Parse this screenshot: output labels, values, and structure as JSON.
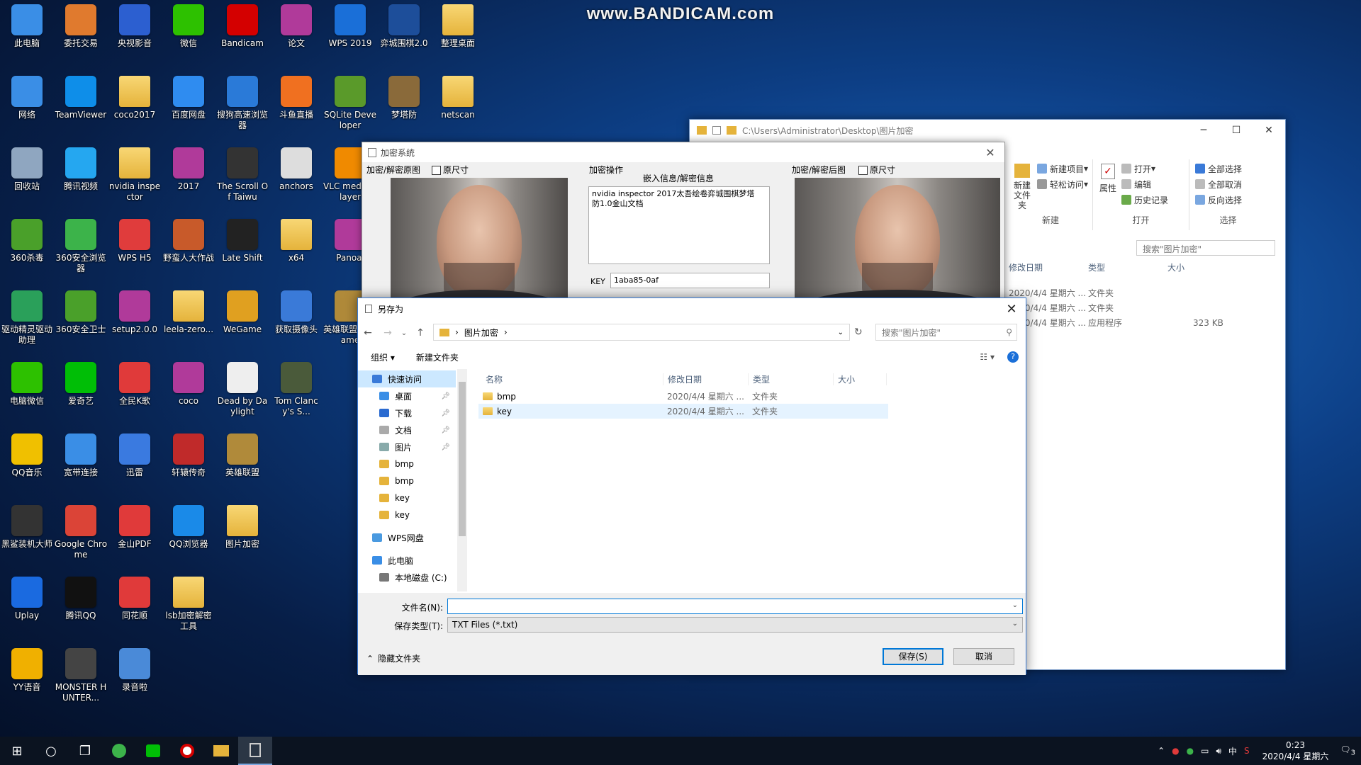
{
  "watermark": "www.BANDICAM.com",
  "desktop_icons": [
    {
      "label": "此电脑",
      "icon": "computer-icon",
      "color": "#3a8ee6"
    },
    {
      "label": "委托交易",
      "icon": "house-icon",
      "color": "#e07a2e"
    },
    {
      "label": "央视影音",
      "icon": "play-icon",
      "color": "#2c5fd0"
    },
    {
      "label": "微信",
      "icon": "wechat-icon",
      "color": "#2dc100"
    },
    {
      "label": "Bandicam",
      "icon": "record-icon",
      "color": "#d40000"
    },
    {
      "label": "论文",
      "icon": "archive-icon",
      "color": "#b03a9a"
    },
    {
      "label": "WPS 2019",
      "icon": "wps-icon",
      "color": "#1a6fd8"
    },
    {
      "label": "弈城围棋2.0",
      "icon": "go-icon",
      "color": "#1d4e9a"
    },
    {
      "label": "整理桌面",
      "icon": "folder-icon",
      "color": "#e5b33b"
    },
    {
      "label": "网络",
      "icon": "network-icon",
      "color": "#3a8ee6"
    },
    {
      "label": "TeamViewer",
      "icon": "teamviewer-icon",
      "color": "#0e8ee9"
    },
    {
      "label": "coco2017",
      "icon": "folder-icon",
      "color": "#e5b33b"
    },
    {
      "label": "百度网盘",
      "icon": "cloud-icon",
      "color": "#2f8cf0"
    },
    {
      "label": "搜狗高速浏览器",
      "icon": "sogou-icon",
      "color": "#2a7ad8"
    },
    {
      "label": "斗鱼直播",
      "icon": "douyu-icon",
      "color": "#f07020"
    },
    {
      "label": "SQLite Developer",
      "icon": "sqlite-icon",
      "color": "#5a9a2a"
    },
    {
      "label": "梦塔防",
      "icon": "game-icon",
      "color": "#8a6a3a"
    },
    {
      "label": "netscan",
      "icon": "folder-icon",
      "color": "#e5b33b"
    },
    {
      "label": "回收站",
      "icon": "recycle-bin-icon",
      "color": "#8fa6c0"
    },
    {
      "label": "腾讯视频",
      "icon": "video-icon",
      "color": "#25a7f0"
    },
    {
      "label": "nvidia inspector",
      "icon": "folder-icon",
      "color": "#e5b33b"
    },
    {
      "label": "2017",
      "icon": "archive-icon",
      "color": "#b03a9a"
    },
    {
      "label": "The Scroll Of Taiwu",
      "icon": "taiwu-icon",
      "color": "#333333"
    },
    {
      "label": "anchors",
      "icon": "document-icon",
      "color": "#dddddd"
    },
    {
      "label": "VLC media player",
      "icon": "vlc-icon",
      "color": "#f08a00"
    },
    {
      "label": "360杀毒",
      "icon": "shield-icon",
      "color": "#4aa02a"
    },
    {
      "label": "360安全浏览器",
      "icon": "browser-icon",
      "color": "#3cb34a"
    },
    {
      "label": "WPS H5",
      "icon": "wps-h5-icon",
      "color": "#e03c3c"
    },
    {
      "label": "野蛮人大作战",
      "icon": "game-icon",
      "color": "#c85a2a"
    },
    {
      "label": "Late Shift",
      "icon": "film-icon",
      "color": "#222222"
    },
    {
      "label": "x64",
      "icon": "folder-icon",
      "color": "#e5b33b"
    },
    {
      "label": "Panoal",
      "icon": "archive-icon",
      "color": "#b03a9a"
    },
    {
      "label": "驱动精灵驱动助理",
      "icon": "driver-icon",
      "color": "#2aa05a"
    },
    {
      "label": "360安全卫士",
      "icon": "guard-icon",
      "color": "#4aa02a"
    },
    {
      "label": "setup2.0.0",
      "icon": "archive-icon",
      "color": "#b03a9a"
    },
    {
      "label": "leela-zero...",
      "icon": "folder-icon",
      "color": "#e5b33b"
    },
    {
      "label": "WeGame",
      "icon": "wegame-icon",
      "color": "#e0a020"
    },
    {
      "label": "获取摄像头",
      "icon": "camera-icon",
      "color": "#3a7ad8"
    },
    {
      "label": "英雄联盟WeGame",
      "icon": "lol-icon",
      "color": "#b08a3a"
    },
    {
      "label": "电脑微信",
      "icon": "wechat-icon",
      "color": "#2dc100"
    },
    {
      "label": "爱奇艺",
      "icon": "iqiyi-icon",
      "color": "#00be06"
    },
    {
      "label": "全民K歌",
      "icon": "karaoke-icon",
      "color": "#e03a3a"
    },
    {
      "label": "coco",
      "icon": "archive-icon",
      "color": "#b03a9a"
    },
    {
      "label": "Dead by Daylight",
      "icon": "document-icon",
      "color": "#eeeeee"
    },
    {
      "label": "Tom Clancy's S...",
      "icon": "game-icon",
      "color": "#4a5a3a"
    },
    {
      "label": "QQ音乐",
      "icon": "music-icon",
      "color": "#f0c000"
    },
    {
      "label": "宽带连接",
      "icon": "network-icon",
      "color": "#3a8ee6"
    },
    {
      "label": "迅雷",
      "icon": "thunder-icon",
      "color": "#3a7ae0"
    },
    {
      "label": "轩辕传奇",
      "icon": "game-icon",
      "color": "#c02a2a"
    },
    {
      "label": "英雄联盟",
      "icon": "lol-icon",
      "color": "#b08a3a"
    },
    {
      "label": "黑鲨装机大师",
      "icon": "shark-icon",
      "color": "#333333"
    },
    {
      "label": "Google Chrome",
      "icon": "chrome-icon",
      "color": "#db4437"
    },
    {
      "label": "金山PDF",
      "icon": "pdf-icon",
      "color": "#e03a3a"
    },
    {
      "label": "QQ浏览器",
      "icon": "qq-browser-icon",
      "color": "#1a8ae8"
    },
    {
      "label": "图片加密",
      "icon": "folder-icon",
      "color": "#e5b33b"
    },
    {
      "label": "Uplay",
      "icon": "uplay-icon",
      "color": "#1a6ae0"
    },
    {
      "label": "腾讯QQ",
      "icon": "qq-icon",
      "color": "#111111"
    },
    {
      "label": "同花顺",
      "icon": "cards-icon",
      "color": "#e03a3a"
    },
    {
      "label": "lsb加密解密工具",
      "icon": "folder-icon",
      "color": "#e5b33b"
    },
    {
      "label": "YY语音",
      "icon": "yy-icon",
      "color": "#f0b000"
    },
    {
      "label": "MONSTER HUNTER...",
      "icon": "game-icon",
      "color": "#444444"
    },
    {
      "label": "录音啦",
      "icon": "recorder-icon",
      "color": "#4a8ad8"
    }
  ],
  "explorer": {
    "path": "C:\\Users\\Administrator\\Desktop\\图片加密",
    "ribbon": {
      "new_item": "新建项目",
      "easy_access": "轻松访问",
      "new_folder": "新建\n文件夹",
      "group_new": "新建",
      "properties": "属性",
      "open": "打开",
      "edit": "编辑",
      "history": "历史记录",
      "group_open": "打开",
      "select_all": "全部选择",
      "select_none": "全部取消",
      "invert": "反向选择",
      "group_select": "选择"
    },
    "search_placeholder": "搜索\"图片加密\"",
    "columns": [
      "修改日期",
      "类型",
      "大小"
    ],
    "rows": [
      {
        "date": "2020/4/4 星期六 ...",
        "type": "文件夹",
        "size": ""
      },
      {
        "date": "2020/4/4 星期六 ...",
        "type": "文件夹",
        "size": ""
      },
      {
        "date": "2020/4/4 星期六 ...",
        "type": "应用程序",
        "size": "323 KB"
      }
    ]
  },
  "enc": {
    "title": "加密系统",
    "left_label": "加密/解密原图",
    "orig_size": "原尺寸",
    "ops_label": "加密操作",
    "embed_label": "嵌入信息/解密信息",
    "info_text": "nvidia inspector 2017太吾绘卷弈城围棋梦塔防1.0金山文档",
    "key_label": "KEY",
    "key_value": "1aba85-0af",
    "right_label": "加密/解密后图",
    "orig_size_right": "原尺寸"
  },
  "save": {
    "title": "另存为",
    "breadcrumb": "图片加密",
    "search_placeholder": "搜索\"图片加密\"",
    "organize": "组织 ▾",
    "new_folder": "新建文件夹",
    "nav": [
      {
        "label": "快速访问",
        "icon": "star-icon",
        "pin": false,
        "sel": true
      },
      {
        "label": "桌面",
        "icon": "desktop-icon",
        "pin": true
      },
      {
        "label": "下载",
        "icon": "download-icon",
        "pin": true
      },
      {
        "label": "文档",
        "icon": "documents-icon",
        "pin": true
      },
      {
        "label": "图片",
        "icon": "pictures-icon",
        "pin": true
      },
      {
        "label": "bmp",
        "icon": "folder-icon",
        "pin": false
      },
      {
        "label": "bmp",
        "icon": "folder-icon",
        "pin": false
      },
      {
        "label": "key",
        "icon": "folder-icon",
        "pin": false
      },
      {
        "label": "key",
        "icon": "folder-icon",
        "pin": false
      },
      {
        "label": "WPS网盘",
        "icon": "cloud-icon",
        "pin": false
      },
      {
        "label": "此电脑",
        "icon": "computer-icon",
        "pin": false
      },
      {
        "label": "本地磁盘 (C:)",
        "icon": "drive-icon",
        "pin": false
      }
    ],
    "columns": {
      "name": "名称",
      "date": "修改日期",
      "type": "类型",
      "size": "大小"
    },
    "files": [
      {
        "name": "bmp",
        "date": "2020/4/4 星期六 ...",
        "type": "文件夹",
        "sel": false
      },
      {
        "name": "key",
        "date": "2020/4/4 星期六 ...",
        "type": "文件夹",
        "sel": true
      }
    ],
    "filename_label": "文件名(N):",
    "filename_value": "",
    "filetype_label": "保存类型(T):",
    "filetype_value": "TXT Files (*.txt)",
    "hide_folders": "隐藏文件夹",
    "save_button": "保存(S)",
    "cancel_button": "取消"
  },
  "taskbar": {
    "time": "0:23",
    "date": "2020/4/4 星期六",
    "ime": "中",
    "notifications": "3"
  }
}
